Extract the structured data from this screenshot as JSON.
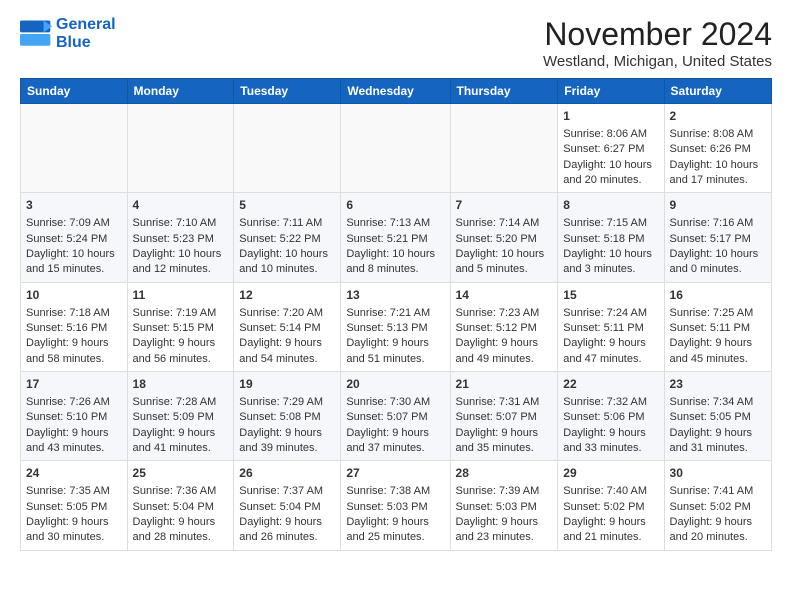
{
  "header": {
    "logo_line1": "General",
    "logo_line2": "Blue",
    "title": "November 2024",
    "subtitle": "Westland, Michigan, United States"
  },
  "days_of_week": [
    "Sunday",
    "Monday",
    "Tuesday",
    "Wednesday",
    "Thursday",
    "Friday",
    "Saturday"
  ],
  "weeks": [
    [
      {
        "day": "",
        "info": ""
      },
      {
        "day": "",
        "info": ""
      },
      {
        "day": "",
        "info": ""
      },
      {
        "day": "",
        "info": ""
      },
      {
        "day": "",
        "info": ""
      },
      {
        "day": "1",
        "info": "Sunrise: 8:06 AM\nSunset: 6:27 PM\nDaylight: 10 hours\nand 20 minutes."
      },
      {
        "day": "2",
        "info": "Sunrise: 8:08 AM\nSunset: 6:26 PM\nDaylight: 10 hours\nand 17 minutes."
      }
    ],
    [
      {
        "day": "3",
        "info": "Sunrise: 7:09 AM\nSunset: 5:24 PM\nDaylight: 10 hours\nand 15 minutes."
      },
      {
        "day": "4",
        "info": "Sunrise: 7:10 AM\nSunset: 5:23 PM\nDaylight: 10 hours\nand 12 minutes."
      },
      {
        "day": "5",
        "info": "Sunrise: 7:11 AM\nSunset: 5:22 PM\nDaylight: 10 hours\nand 10 minutes."
      },
      {
        "day": "6",
        "info": "Sunrise: 7:13 AM\nSunset: 5:21 PM\nDaylight: 10 hours\nand 8 minutes."
      },
      {
        "day": "7",
        "info": "Sunrise: 7:14 AM\nSunset: 5:20 PM\nDaylight: 10 hours\nand 5 minutes."
      },
      {
        "day": "8",
        "info": "Sunrise: 7:15 AM\nSunset: 5:18 PM\nDaylight: 10 hours\nand 3 minutes."
      },
      {
        "day": "9",
        "info": "Sunrise: 7:16 AM\nSunset: 5:17 PM\nDaylight: 10 hours\nand 0 minutes."
      }
    ],
    [
      {
        "day": "10",
        "info": "Sunrise: 7:18 AM\nSunset: 5:16 PM\nDaylight: 9 hours\nand 58 minutes."
      },
      {
        "day": "11",
        "info": "Sunrise: 7:19 AM\nSunset: 5:15 PM\nDaylight: 9 hours\nand 56 minutes."
      },
      {
        "day": "12",
        "info": "Sunrise: 7:20 AM\nSunset: 5:14 PM\nDaylight: 9 hours\nand 54 minutes."
      },
      {
        "day": "13",
        "info": "Sunrise: 7:21 AM\nSunset: 5:13 PM\nDaylight: 9 hours\nand 51 minutes."
      },
      {
        "day": "14",
        "info": "Sunrise: 7:23 AM\nSunset: 5:12 PM\nDaylight: 9 hours\nand 49 minutes."
      },
      {
        "day": "15",
        "info": "Sunrise: 7:24 AM\nSunset: 5:11 PM\nDaylight: 9 hours\nand 47 minutes."
      },
      {
        "day": "16",
        "info": "Sunrise: 7:25 AM\nSunset: 5:11 PM\nDaylight: 9 hours\nand 45 minutes."
      }
    ],
    [
      {
        "day": "17",
        "info": "Sunrise: 7:26 AM\nSunset: 5:10 PM\nDaylight: 9 hours\nand 43 minutes."
      },
      {
        "day": "18",
        "info": "Sunrise: 7:28 AM\nSunset: 5:09 PM\nDaylight: 9 hours\nand 41 minutes."
      },
      {
        "day": "19",
        "info": "Sunrise: 7:29 AM\nSunset: 5:08 PM\nDaylight: 9 hours\nand 39 minutes."
      },
      {
        "day": "20",
        "info": "Sunrise: 7:30 AM\nSunset: 5:07 PM\nDaylight: 9 hours\nand 37 minutes."
      },
      {
        "day": "21",
        "info": "Sunrise: 7:31 AM\nSunset: 5:07 PM\nDaylight: 9 hours\nand 35 minutes."
      },
      {
        "day": "22",
        "info": "Sunrise: 7:32 AM\nSunset: 5:06 PM\nDaylight: 9 hours\nand 33 minutes."
      },
      {
        "day": "23",
        "info": "Sunrise: 7:34 AM\nSunset: 5:05 PM\nDaylight: 9 hours\nand 31 minutes."
      }
    ],
    [
      {
        "day": "24",
        "info": "Sunrise: 7:35 AM\nSunset: 5:05 PM\nDaylight: 9 hours\nand 30 minutes."
      },
      {
        "day": "25",
        "info": "Sunrise: 7:36 AM\nSunset: 5:04 PM\nDaylight: 9 hours\nand 28 minutes."
      },
      {
        "day": "26",
        "info": "Sunrise: 7:37 AM\nSunset: 5:04 PM\nDaylight: 9 hours\nand 26 minutes."
      },
      {
        "day": "27",
        "info": "Sunrise: 7:38 AM\nSunset: 5:03 PM\nDaylight: 9 hours\nand 25 minutes."
      },
      {
        "day": "28",
        "info": "Sunrise: 7:39 AM\nSunset: 5:03 PM\nDaylight: 9 hours\nand 23 minutes."
      },
      {
        "day": "29",
        "info": "Sunrise: 7:40 AM\nSunset: 5:02 PM\nDaylight: 9 hours\nand 21 minutes."
      },
      {
        "day": "30",
        "info": "Sunrise: 7:41 AM\nSunset: 5:02 PM\nDaylight: 9 hours\nand 20 minutes."
      }
    ]
  ]
}
